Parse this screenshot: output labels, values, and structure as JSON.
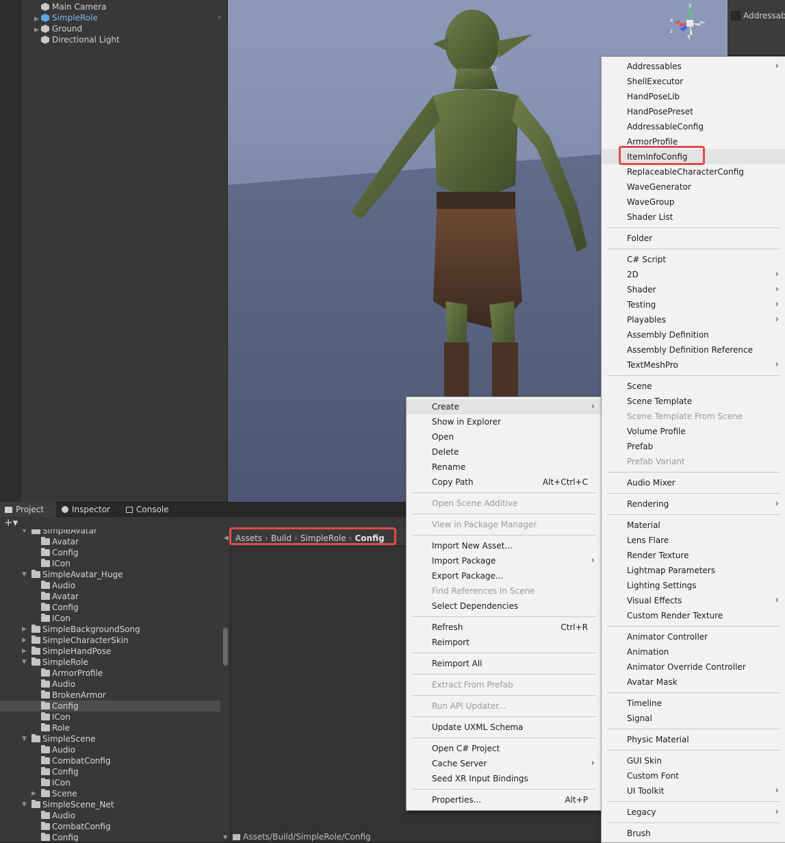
{
  "hierarchy": {
    "items": [
      {
        "label": "Main Camera",
        "expandable": false,
        "selected_blue": false
      },
      {
        "label": "SimpleRole",
        "expandable": true,
        "selected_blue": true
      },
      {
        "label": "Ground",
        "expandable": true,
        "selected_blue": false
      },
      {
        "label": "Directional Light",
        "expandable": false,
        "selected_blue": false
      }
    ]
  },
  "scene": {
    "gizmo_axes": {
      "x": "x",
      "y": "y",
      "z": "z"
    },
    "colors": {
      "sky": "#8c98b8",
      "ground": "#5a6480"
    }
  },
  "inspector": {
    "addressable_label": "Addressabl"
  },
  "tabs": [
    {
      "label": "Project",
      "icon": "folder-icon",
      "active": true
    },
    {
      "label": "Inspector",
      "icon": "info-icon",
      "active": false
    },
    {
      "label": "Console",
      "icon": "console-icon",
      "active": false
    }
  ],
  "project_toolbar": {
    "add_label": "+▾"
  },
  "project_tree": [
    {
      "label": "SimpleAvatar",
      "level": 0,
      "expanded": true
    },
    {
      "label": "Avatar",
      "level": 1
    },
    {
      "label": "Config",
      "level": 1
    },
    {
      "label": "ICon",
      "level": 1
    },
    {
      "label": "SimpleAvatar_Huge",
      "level": 0,
      "expanded": true
    },
    {
      "label": "Audio",
      "level": 1
    },
    {
      "label": "Avatar",
      "level": 1
    },
    {
      "label": "Config",
      "level": 1
    },
    {
      "label": "ICon",
      "level": 1
    },
    {
      "label": "SimpleBackgroundSong",
      "level": 0,
      "expanded": false
    },
    {
      "label": "SimpleCharacterSkin",
      "level": 0,
      "expanded": false
    },
    {
      "label": "SimpleHandPose",
      "level": 0,
      "expanded": false
    },
    {
      "label": "SimpleRole",
      "level": 0,
      "expanded": true
    },
    {
      "label": "ArmorProfile",
      "level": 1
    },
    {
      "label": "Audio",
      "level": 1
    },
    {
      "label": "BrokenArmor",
      "level": 1
    },
    {
      "label": "Config",
      "level": 1,
      "selected": true
    },
    {
      "label": "ICon",
      "level": 1
    },
    {
      "label": "Role",
      "level": 1
    },
    {
      "label": "SimpleScene",
      "level": 0,
      "expanded": true
    },
    {
      "label": "Audio",
      "level": 1
    },
    {
      "label": "CombatConfig",
      "level": 1
    },
    {
      "label": "Config",
      "level": 1
    },
    {
      "label": "ICon",
      "level": 1
    },
    {
      "label": "Scene",
      "level": 1,
      "expandable": true
    },
    {
      "label": "SimpleScene_Net",
      "level": 0,
      "expanded": true
    },
    {
      "label": "Audio",
      "level": 1
    },
    {
      "label": "CombatConfig",
      "level": 1
    },
    {
      "label": "Config",
      "level": 1
    }
  ],
  "breadcrumb": {
    "parts": [
      "Assets",
      "Build",
      "SimpleRole",
      "Config"
    ],
    "separator": "›"
  },
  "bottom_path": "Assets/Build/SimpleRole/Config",
  "context_menu": {
    "items": [
      {
        "label": "Create",
        "submenu": true,
        "highlight": true
      },
      {
        "label": "Show in Explorer"
      },
      {
        "label": "Open"
      },
      {
        "label": "Delete"
      },
      {
        "label": "Rename"
      },
      {
        "label": "Copy Path",
        "shortcut": "Alt+Ctrl+C"
      },
      {
        "sep": true
      },
      {
        "label": "Open Scene Additive",
        "disabled": true
      },
      {
        "sep": true
      },
      {
        "label": "View in Package Manager",
        "disabled": true
      },
      {
        "sep": true
      },
      {
        "label": "Import New Asset..."
      },
      {
        "label": "Import Package",
        "submenu": true
      },
      {
        "label": "Export Package..."
      },
      {
        "label": "Find References In Scene",
        "disabled": true
      },
      {
        "label": "Select Dependencies"
      },
      {
        "sep": true
      },
      {
        "label": "Refresh",
        "shortcut": "Ctrl+R"
      },
      {
        "label": "Reimport"
      },
      {
        "sep": true
      },
      {
        "label": "Reimport All"
      },
      {
        "sep": true
      },
      {
        "label": "Extract From Prefab",
        "disabled": true
      },
      {
        "sep": true
      },
      {
        "label": "Run API Updater...",
        "disabled": true
      },
      {
        "sep": true
      },
      {
        "label": "Update UXML Schema"
      },
      {
        "sep": true
      },
      {
        "label": "Open C# Project"
      },
      {
        "label": "Cache Server",
        "submenu": true
      },
      {
        "label": "Seed XR Input Bindings"
      },
      {
        "sep": true
      },
      {
        "label": "Properties...",
        "shortcut": "Alt+P"
      }
    ]
  },
  "create_menu": {
    "items": [
      {
        "label": "Addressables",
        "submenu": true
      },
      {
        "label": "ShellExecutor"
      },
      {
        "label": "HandPoseLib"
      },
      {
        "label": "HandPosePreset"
      },
      {
        "label": "AddressableConfig"
      },
      {
        "label": "ArmorProfile"
      },
      {
        "label": "ItemInfoConfig",
        "highlight": true
      },
      {
        "label": "ReplaceableCharacterConfig"
      },
      {
        "label": "WaveGenerator"
      },
      {
        "label": "WaveGroup"
      },
      {
        "label": "Shader List"
      },
      {
        "sep": true
      },
      {
        "label": "Folder"
      },
      {
        "sep": true
      },
      {
        "label": "C# Script"
      },
      {
        "label": "2D",
        "submenu": true
      },
      {
        "label": "Shader",
        "submenu": true
      },
      {
        "label": "Testing",
        "submenu": true
      },
      {
        "label": "Playables",
        "submenu": true
      },
      {
        "label": "Assembly Definition"
      },
      {
        "label": "Assembly Definition Reference"
      },
      {
        "label": "TextMeshPro",
        "submenu": true
      },
      {
        "sep": true
      },
      {
        "label": "Scene"
      },
      {
        "label": "Scene Template"
      },
      {
        "label": "Scene Template From Scene",
        "disabled": true
      },
      {
        "label": "Volume Profile"
      },
      {
        "label": "Prefab"
      },
      {
        "label": "Prefab Variant",
        "disabled": true
      },
      {
        "sep": true
      },
      {
        "label": "Audio Mixer"
      },
      {
        "sep": true
      },
      {
        "label": "Rendering",
        "submenu": true
      },
      {
        "sep": true
      },
      {
        "label": "Material"
      },
      {
        "label": "Lens Flare"
      },
      {
        "label": "Render Texture"
      },
      {
        "label": "Lightmap Parameters"
      },
      {
        "label": "Lighting Settings"
      },
      {
        "label": "Visual Effects",
        "submenu": true
      },
      {
        "label": "Custom Render Texture"
      },
      {
        "sep": true
      },
      {
        "label": "Animator Controller"
      },
      {
        "label": "Animation"
      },
      {
        "label": "Animator Override Controller"
      },
      {
        "label": "Avatar Mask"
      },
      {
        "sep": true
      },
      {
        "label": "Timeline"
      },
      {
        "label": "Signal"
      },
      {
        "sep": true
      },
      {
        "label": "Physic Material"
      },
      {
        "sep": true
      },
      {
        "label": "GUI Skin"
      },
      {
        "label": "Custom Font"
      },
      {
        "label": "UI Toolkit",
        "submenu": true
      },
      {
        "sep": true
      },
      {
        "label": "Legacy",
        "submenu": true
      },
      {
        "sep": true
      },
      {
        "label": "Brush"
      }
    ]
  }
}
